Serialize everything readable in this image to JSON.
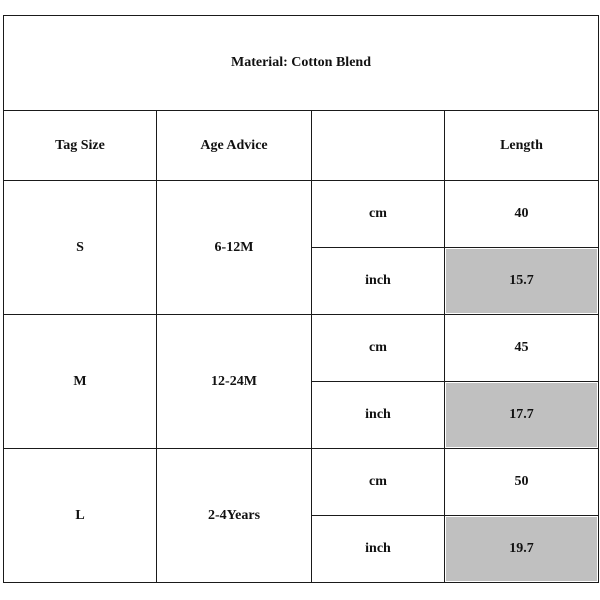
{
  "title": "Material: Cotton Blend",
  "headers": [
    "Tag Size",
    "Age Advice",
    "",
    "Length"
  ],
  "shade_color": "#c0c0c0",
  "rows": [
    {
      "tag_size": "S",
      "age": "6-12M",
      "units": [
        {
          "unit": "cm",
          "length": "40"
        },
        {
          "unit": "inch",
          "length": "15.7"
        }
      ]
    },
    {
      "tag_size": "M",
      "age": "12-24M",
      "units": [
        {
          "unit": "cm",
          "length": "45"
        },
        {
          "unit": "inch",
          "length": "17.7"
        }
      ]
    },
    {
      "tag_size": "L",
      "age": "2-4Years",
      "units": [
        {
          "unit": "cm",
          "length": "50"
        },
        {
          "unit": "inch",
          "length": "19.7"
        }
      ]
    }
  ]
}
